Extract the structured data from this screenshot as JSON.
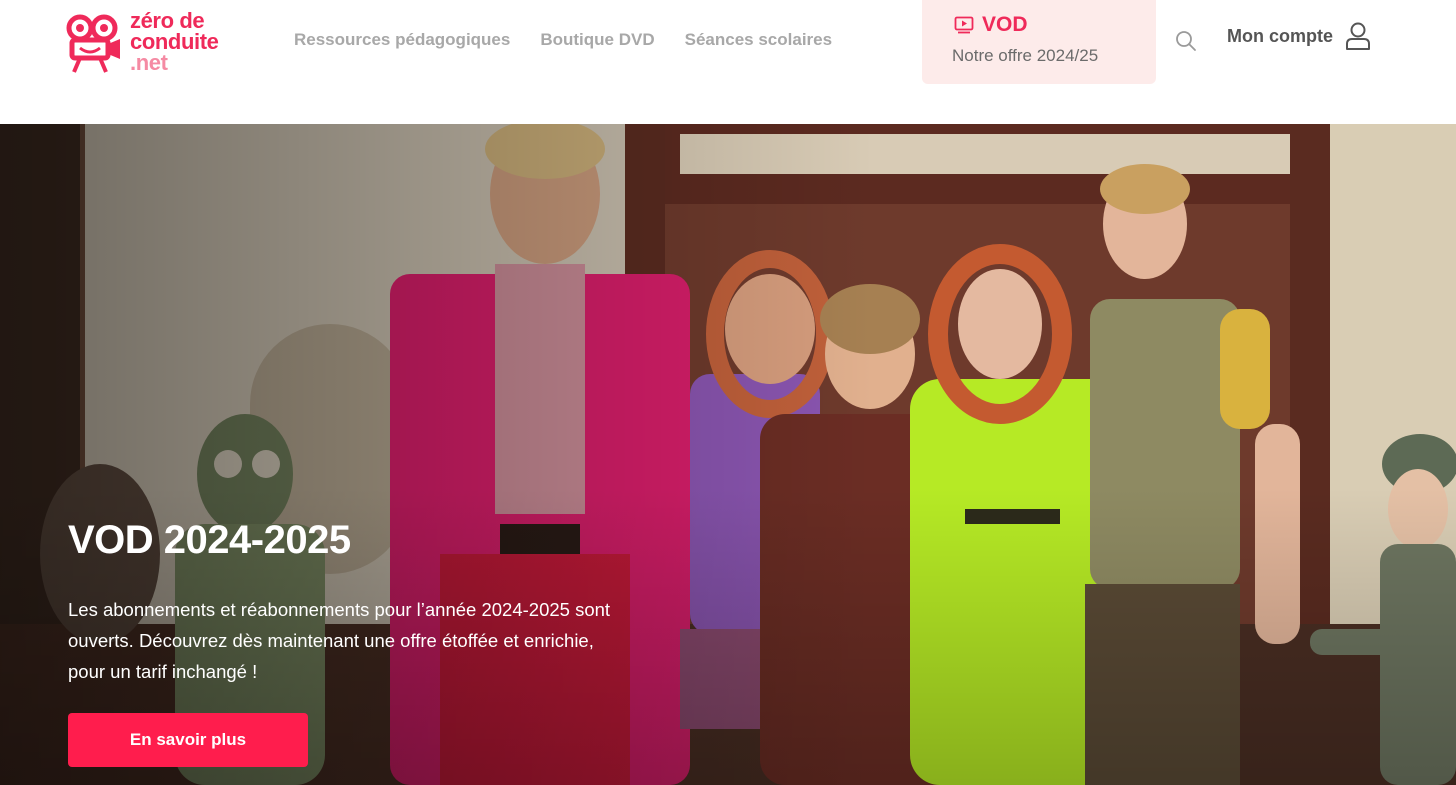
{
  "brand": {
    "line1": "zéro de",
    "line2": "conduite",
    "line3": ".net",
    "color": "#ef2a5a",
    "icon": "film-camera-icon"
  },
  "nav": {
    "items": [
      {
        "label": "Ressources pédagogiques"
      },
      {
        "label": "Boutique DVD"
      },
      {
        "label": "Séances scolaires"
      }
    ]
  },
  "vod": {
    "label": "VOD",
    "subtitle": "Notre offre 2024/25",
    "icon": "video-play-icon",
    "background": "#fdebea"
  },
  "search": {
    "icon": "search-icon"
  },
  "account": {
    "label": "Mon compte",
    "icon": "user-icon"
  },
  "hero": {
    "title": "VOD 2024-2025",
    "description": "Les abonnements et réabonnements pour l’année 2024-2025 sont ouverts. Découvrez dès maintenant une offre étoffée et enrichie, pour un tarif inchangé !",
    "button_label": "En savoir plus",
    "button_color": "#ff1d4d"
  }
}
